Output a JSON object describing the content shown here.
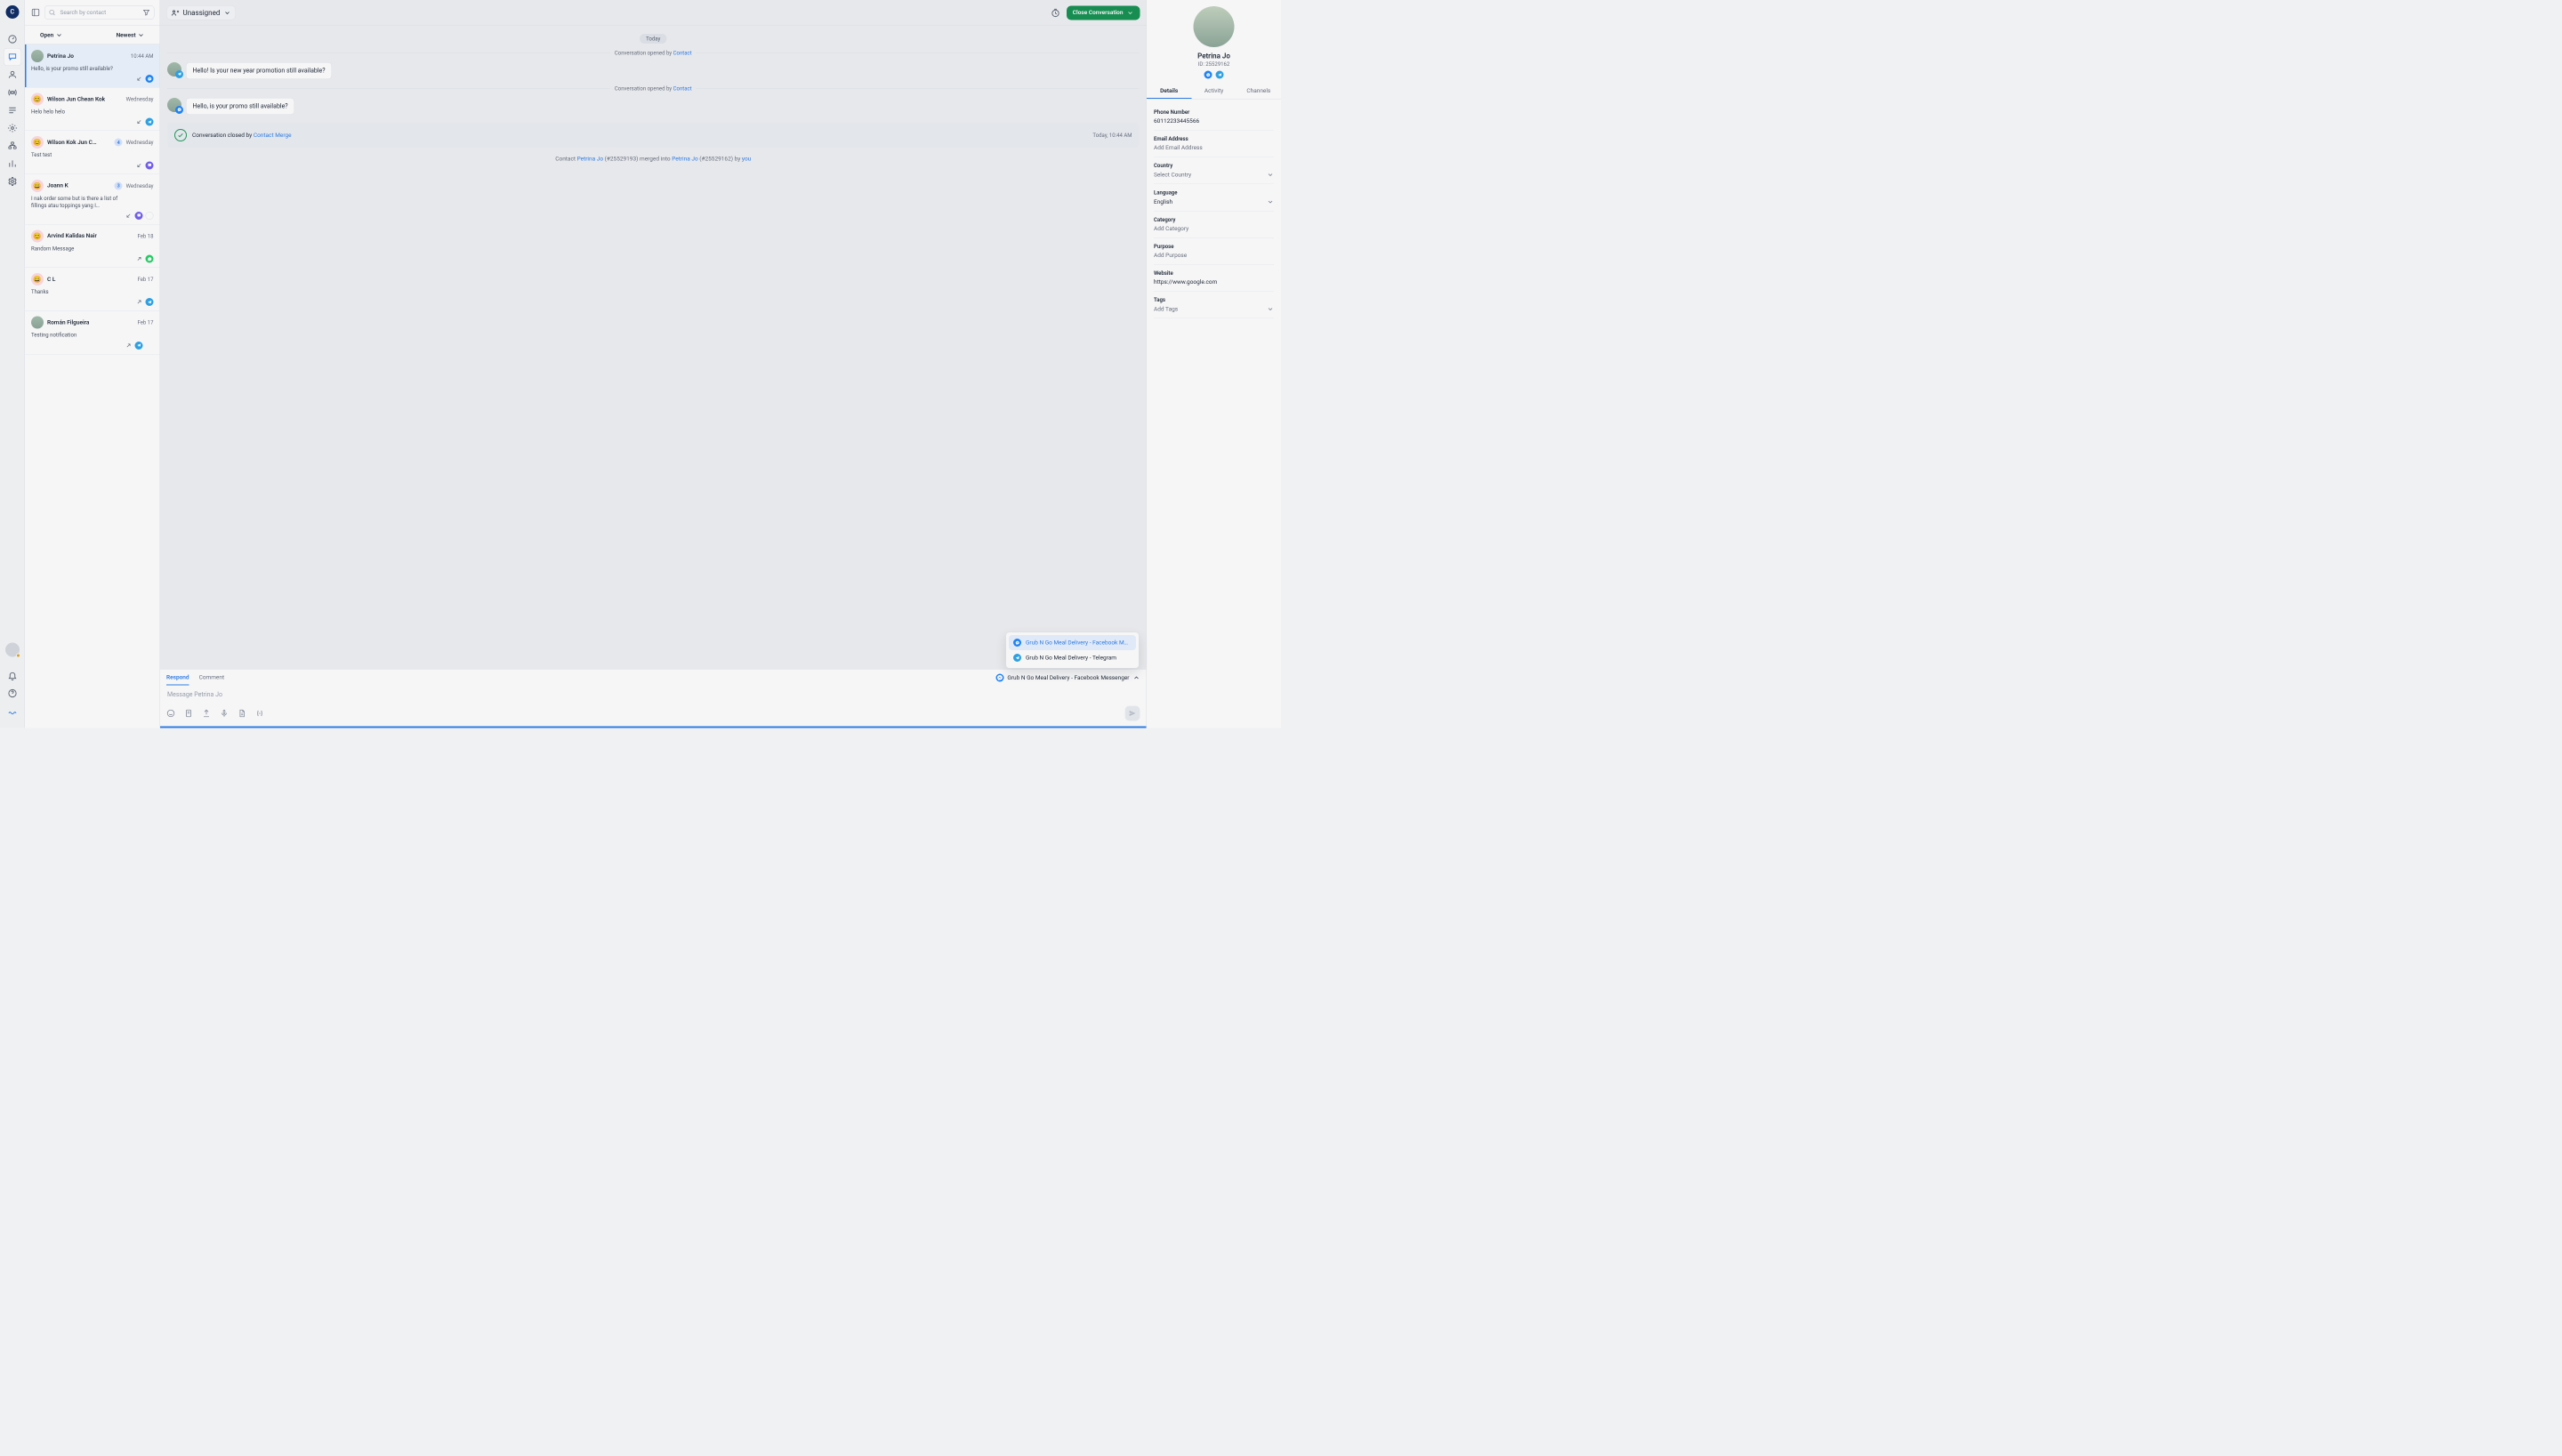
{
  "workspace_initial": "C",
  "search": {
    "placeholder": "Search by contact",
    "value": ""
  },
  "filters": {
    "status": "Open",
    "sort": "Newest"
  },
  "sidebar_icons": [
    "dashboard",
    "chat",
    "contacts",
    "broadcast",
    "workflows",
    "settings-gear",
    "org",
    "reports",
    "settings"
  ],
  "bottom_icons": [
    "bell",
    "help",
    "wave"
  ],
  "conversations": [
    {
      "name": "Petrina Jo",
      "time": "10:44 AM",
      "preview": "Hello, is your promo still available?",
      "avatar": "photo",
      "dir": "in",
      "channels": [
        "fb"
      ],
      "active": true
    },
    {
      "name": "Wilson Jun Chean Kok",
      "time": "Wednesday",
      "preview": "Helo helo helo",
      "avatar": "pink",
      "emoji": "😊",
      "dir": "in",
      "channels": [
        "tg"
      ]
    },
    {
      "name": "Wilson Kok Jun C…",
      "time": "Wednesday",
      "preview": "Test test",
      "avatar": "pink",
      "emoji": "😊",
      "dir": "in",
      "channels": [
        "vi"
      ],
      "badge": "4"
    },
    {
      "name": "Joann K",
      "time": "Wednesday",
      "preview": "I nak order some but is there a list of fillings atau toppings yang I…",
      "avatar": "pink",
      "emoji": "😀",
      "dir": "in",
      "channels": [
        "vi",
        "bot"
      ],
      "badge": "3"
    },
    {
      "name": "Arvind Kalidas Nair",
      "time": "Feb 18",
      "preview": "Random Message",
      "avatar": "pink",
      "emoji": "😊",
      "dir": "out",
      "channels": [
        "wa"
      ]
    },
    {
      "name": "C L",
      "time": "Feb 17",
      "preview": "Thanks",
      "avatar": "pink",
      "emoji": "😄",
      "dir": "out",
      "channels": [
        "tg"
      ]
    },
    {
      "name": "Román Filgueira",
      "time": "Feb 17",
      "preview": "Testing notification",
      "avatar": "photo",
      "dir": "out",
      "channels": [
        "tg",
        "agent"
      ]
    }
  ],
  "thread": {
    "assignee": "Unassigned",
    "close_label": "Close Conversation",
    "day": "Today",
    "opened_label": "Conversation opened by ",
    "opened_link": "Contact",
    "messages": [
      {
        "text": "Hello! Is your new year promotion still available?",
        "channel": "tg"
      },
      {
        "text": "Hello, is your promo still available?",
        "channel": "fb"
      }
    ],
    "closed": {
      "prefix": "Conversation closed by ",
      "link": "Contact Merge",
      "time": "Today, 10:44 AM"
    },
    "merge": {
      "prefix": "Contact ",
      "name": "Petrina Jo",
      "id1": " (#25529193) ",
      "mid": "merged into ",
      "id2": " (#25529162) ",
      "by_label": "by ",
      "by_link": "you"
    }
  },
  "channel_options": [
    {
      "label": "Grub N Go Meal Delivery - Facebook M…",
      "channel": "fb",
      "selected": true
    },
    {
      "label": "Grub N Go Meal Delivery - Telegram",
      "channel": "tg",
      "selected": false
    }
  ],
  "composer": {
    "tabs": [
      "Respond",
      "Comment"
    ],
    "channel_label": "Grub N Go Meal Delivery - Facebook Messenger",
    "placeholder": "Message Petrina Jo",
    "value": ""
  },
  "contact": {
    "name": "Petrina Jo",
    "id": "ID: 25529162",
    "channels": [
      "fb",
      "tg"
    ],
    "tabs": [
      "Details",
      "Activity",
      "Channels"
    ],
    "fields": [
      {
        "label": "Phone Number",
        "value": "60112233445566",
        "has": true
      },
      {
        "label": "Email Address",
        "value": "Add Email Address",
        "has": false
      },
      {
        "label": "Country",
        "value": "Select Country",
        "has": false,
        "select": true
      },
      {
        "label": "Language",
        "value": "English",
        "has": true,
        "select": true
      },
      {
        "label": "Category",
        "value": "Add Category",
        "has": false
      },
      {
        "label": "Purpose",
        "value": "Add Purpose",
        "has": false
      },
      {
        "label": "Website",
        "value": "https://www.google.com",
        "has": true
      },
      {
        "label": "Tags",
        "value": "Add Tags",
        "has": false,
        "select": true
      }
    ]
  }
}
